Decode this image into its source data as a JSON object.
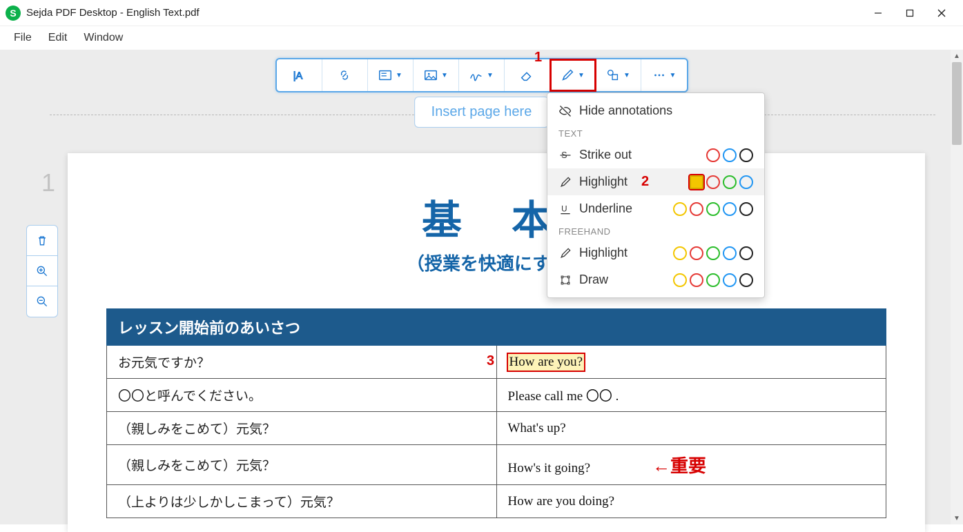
{
  "window": {
    "title": "Sejda PDF Desktop - English Text.pdf",
    "app_initial": "S"
  },
  "menubar": {
    "file": "File",
    "edit": "Edit",
    "window": "Window"
  },
  "insert_page": "Insert page here",
  "page_number": "1",
  "labels": {
    "l1": "1",
    "l2": "2",
    "l3": "3"
  },
  "dropdown": {
    "hide_annotations": "Hide annotations",
    "section_text": "TEXT",
    "strike_out": "Strike out",
    "highlight": "Highlight",
    "underline": "Underline",
    "section_freehand": "FREEHAND",
    "fh_highlight": "Highlight",
    "fh_draw": "Draw",
    "colors": {
      "yellow": "#f3c600",
      "red": "#e53935",
      "green": "#2bbd2b",
      "blue": "#2196f3",
      "black": "#222222"
    }
  },
  "document": {
    "title": "基 本",
    "subtitle": "（授業を快適にするフ",
    "table_header": "レッスン開始前のあいさつ",
    "rows": [
      {
        "jp": "お元気ですか？",
        "en": "How are you?"
      },
      {
        "jp": "〇〇と呼んでください。",
        "en": "Please call me 〇〇 ."
      },
      {
        "jp": "（親しみをこめて）元気？",
        "en": "What's up?"
      },
      {
        "jp": "（親しみをこめて）元気？",
        "en": "How's it going?"
      },
      {
        "jp": "（上よりは少しかしこまって）元気？",
        "en": "How are you doing?"
      }
    ],
    "annotation_note": "←重要"
  }
}
